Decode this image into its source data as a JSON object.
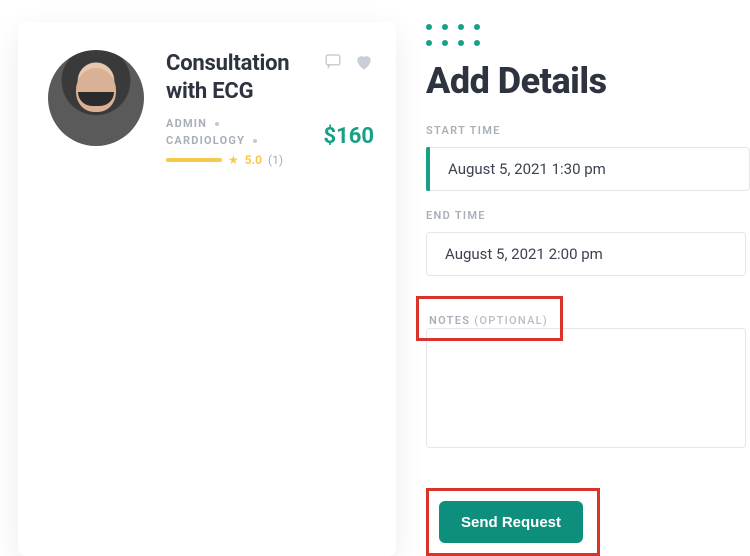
{
  "card": {
    "title": "Consultation with ECG",
    "meta_admin": "ADMIN",
    "meta_dept": "CARDIOLOGY",
    "rating_value": "5.0",
    "rating_count": "(1)",
    "price": "$160"
  },
  "form": {
    "heading": "Add Details",
    "start_label": "START TIME",
    "start_value": "August 5, 2021 1:30 pm",
    "end_label": "END TIME",
    "end_value": "August 5, 2021 2:00 pm",
    "notes_label": "NOTES ",
    "notes_optional": "(OPTIONAL)",
    "send_label": "Send Request"
  }
}
